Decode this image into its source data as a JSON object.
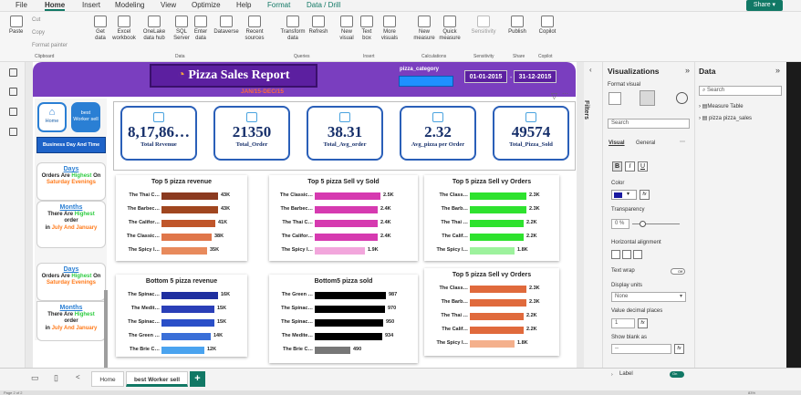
{
  "menu": {
    "tabs": [
      "File",
      "Home",
      "Insert",
      "Modeling",
      "View",
      "Optimize",
      "Help",
      "Format",
      "Data / Drill"
    ],
    "share": "Share"
  },
  "ribbon": {
    "clipboard": {
      "paste": "Paste",
      "cut": "Cut",
      "copy": "Copy",
      "format_painter": "Format painter",
      "group": "Clipboard"
    },
    "data": {
      "get_data": "Get data",
      "excel": "Excel workbook",
      "onelake": "OneLake data hub",
      "sql": "SQL Server",
      "enter": "Enter data",
      "dataverse": "Dataverse",
      "recent": "Recent sources",
      "group": "Data"
    },
    "queries": {
      "transform": "Transform data",
      "refresh": "Refresh",
      "group": "Queries"
    },
    "insert": {
      "new_visual": "New visual",
      "text_box": "Text box",
      "more_visuals": "More visuals",
      "group": "Insert"
    },
    "calculations": {
      "new_measure": "New measure",
      "quick_measure": "Quick measure",
      "group": "Calculations"
    },
    "sensitivity": {
      "label": "Sensitivity",
      "group": "Sensitivity"
    },
    "share": {
      "publish": "Publish",
      "group": "Share"
    },
    "copilot": {
      "label": "Copilot",
      "group": "Copilot"
    }
  },
  "report": {
    "title": "Pizza Sales Report",
    "subtitle": "JAN/15-DEC/15",
    "slicer_label": "pizza_category",
    "date_from": "01-01-2015",
    "date_dash": "-",
    "date_to": "31-12-2015"
  },
  "nav": {
    "home": "Home",
    "best_worker": "best Worker sell",
    "business": "Business Day And Time"
  },
  "insights": [
    {
      "head": "Days",
      "l1": "Orders Are ",
      "l1b": "Highest",
      "l1c": " On",
      "l2": "Saturday Evenings"
    },
    {
      "head": "Months",
      "l1": "There Are ",
      "l1b": "Highest",
      "l2": "order",
      "l3": "in ",
      "l3b": "July And January"
    },
    {
      "head": "Days",
      "l1": "Orders Are ",
      "l1b": "Highest",
      "l1c": " On",
      "l2": "Saturday Evenings"
    },
    {
      "head": "Months",
      "l1": "There Are ",
      "l1b": "Highest",
      "l2": "order",
      "l3": "in ",
      "l3b": "July And January"
    }
  ],
  "kpis": [
    {
      "value": "8,17,86…",
      "label": "Total Revenue",
      "icon": "revenue-icon"
    },
    {
      "value": "21350",
      "label": "Total_Order",
      "icon": "order-icon"
    },
    {
      "value": "38.31",
      "label": "Total_Avg_order",
      "icon": "clipboard-icon"
    },
    {
      "value": "2.32",
      "label": "Avg_pizza per Order",
      "icon": "pizza-icon"
    },
    {
      "value": "49574",
      "label": "Total_Pizza_Sold",
      "icon": "people-icon"
    }
  ],
  "chart_data": [
    {
      "type": "bar",
      "title": "Top 5 pizza revenue",
      "categories": [
        "The Thai C…",
        "The Barbec…",
        "The Califor…",
        "The Classic…",
        "The Spicy I…"
      ],
      "values": [
        43,
        43,
        41,
        38,
        35
      ],
      "value_labels": [
        "43K",
        "43K",
        "41K",
        "38K",
        "35K"
      ],
      "colors": [
        "#8b3a1f",
        "#a0461f",
        "#c0562a",
        "#e0764a",
        "#e88a5c"
      ]
    },
    {
      "type": "bar",
      "title": "Top 5 pizza Sell vy Sold",
      "categories": [
        "The Classic…",
        "The Barbec…",
        "The Thai C…",
        "The Califor…",
        "The Spicy I…"
      ],
      "values": [
        2.5,
        2.4,
        2.4,
        2.4,
        1.9
      ],
      "value_labels": [
        "2.5K",
        "2.4K",
        "2.4K",
        "2.4K",
        "1.9K"
      ],
      "colors": [
        "#d63ab0",
        "#d63ab0",
        "#d63ab0",
        "#d63ab0",
        "#f2a6dc"
      ]
    },
    {
      "type": "bar",
      "title": "Top 5 pizza Sell vy Orders",
      "categories": [
        "The Class…",
        "The Barb…",
        "The Thai …",
        "The Calif…",
        "The Spicy I…"
      ],
      "values": [
        2.3,
        2.3,
        2.2,
        2.2,
        1.8
      ],
      "value_labels": [
        "2.3K",
        "2.3K",
        "2.2K",
        "2.2K",
        "1.8K"
      ],
      "colors": [
        "#2ee22e",
        "#2ee22e",
        "#2ee22e",
        "#2ee22e",
        "#9df29d"
      ]
    },
    {
      "type": "bar",
      "title": "Bottom 5 pizza revenue",
      "categories": [
        "The Spinac…",
        "The Medit…",
        "The Spinac…",
        "The Green …",
        "The Brie C…"
      ],
      "values": [
        16,
        15,
        15,
        14,
        12
      ],
      "value_labels": [
        "16K",
        "15K",
        "15K",
        "14K",
        "12K"
      ],
      "colors": [
        "#1f2fa0",
        "#2a3fb8",
        "#2a4fc8",
        "#3a6fd8",
        "#4aa3ef"
      ]
    },
    {
      "type": "bar",
      "title": "Bottom5 pizza sold",
      "categories": [
        "The Green …",
        "The Spinac…",
        "The Spinac…",
        "The Medite…",
        "The Brie C…"
      ],
      "values": [
        987,
        970,
        950,
        934,
        490
      ],
      "value_labels": [
        "987",
        "970",
        "950",
        "934",
        "490"
      ],
      "colors": [
        "#000000",
        "#000000",
        "#000000",
        "#000000",
        "#777777"
      ]
    },
    {
      "type": "bar",
      "title": "Top 5 pizza Sell vy Orders",
      "categories": [
        "The Class…",
        "The Barb…",
        "The Thai …",
        "The Calif…",
        "The Spicy I…"
      ],
      "values": [
        2.3,
        2.3,
        2.2,
        2.2,
        1.8
      ],
      "value_labels": [
        "2.3K",
        "2.3K",
        "2.2K",
        "2.2K",
        "1.8K"
      ],
      "colors": [
        "#e06a3c",
        "#e06a3c",
        "#e06a3c",
        "#e06a3c",
        "#f4b08c"
      ]
    }
  ],
  "pages": {
    "tab1": "Home",
    "tab2": "best Worker sell",
    "add": "+",
    "status": "Page 2 of 2",
    "zoom": "83%"
  },
  "filters": {
    "label": "Filters"
  },
  "viz": {
    "title": "Visualizations",
    "format_visual": "Format visual",
    "search": "Search",
    "tab_visual": "Visual",
    "tab_general": "General",
    "color": "Color",
    "fx": "fx",
    "transparency": "Transparency",
    "transparency_val": "0 %",
    "horiz_align": "Horizontal alignment",
    "text_wrap": "Text wrap",
    "text_wrap_state": "Off",
    "display_units": "Display units",
    "display_units_val": "None",
    "decimal": "Value decimal places",
    "decimal_val": "1",
    "show_blank": "Show blank as",
    "show_blank_val": "--",
    "label": "Label",
    "label_state": "On",
    "bold": "B",
    "italic": "I",
    "underline": "U"
  },
  "datap": {
    "title": "Data",
    "search": "Search",
    "items": [
      "Measure Table",
      "pizza pizza_sales"
    ]
  }
}
